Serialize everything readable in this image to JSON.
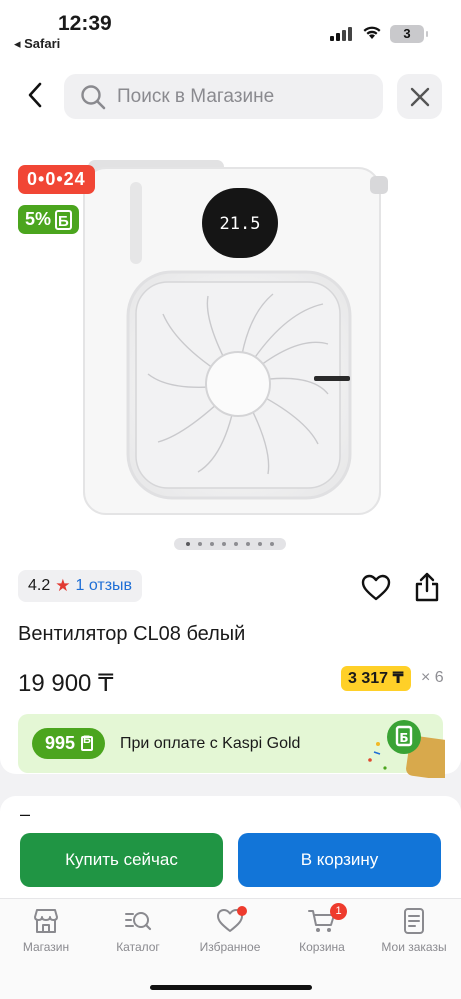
{
  "status_bar": {
    "time": "12:39",
    "back_app": "◂ Safari",
    "battery": "3"
  },
  "search": {
    "placeholder": "Поиск в Магазине"
  },
  "product": {
    "timer_badge": "0•0•24",
    "bonus_badge": "5%",
    "image_icon": "air-cooler-fan-image",
    "display_reading": "21.5",
    "rating": "4.2",
    "reviews": "1 отзыв",
    "title": "Вентилятор CL08 белый",
    "price": "19 900 ₸",
    "installment": "3 317 ₸",
    "installment_mult": "× 6",
    "gallery_dots": 8,
    "gallery_active": 0
  },
  "kaspi_gold": {
    "bonus": "995",
    "text": "При оплате с Kaspi Gold"
  },
  "actions": {
    "dash": "–",
    "buy_now": "Купить сейчас",
    "add_to_cart": "В корзину"
  },
  "tabbar": {
    "items": [
      {
        "label": "Магазин",
        "icon": "store-icon"
      },
      {
        "label": "Каталог",
        "icon": "catalog-search-icon"
      },
      {
        "label": "Избранное",
        "icon": "heart-icon"
      },
      {
        "label": "Корзина",
        "icon": "cart-icon",
        "badge": "1"
      },
      {
        "label": "Мои заказы",
        "icon": "orders-icon"
      }
    ]
  },
  "colors": {
    "timer_red": "#f14635",
    "bonus_green": "#4ba51e",
    "installment_yellow": "#ffd028",
    "buy_green": "#209544",
    "cart_blue": "#1275d8",
    "review_link": "#1f6fd6"
  }
}
